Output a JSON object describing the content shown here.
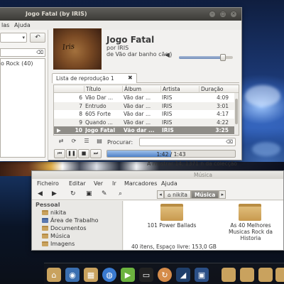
{
  "rhythmbox": {
    "window_title": "Jogo Fatal (by IRIS)",
    "menu": [
      "las",
      "Ajuda"
    ],
    "sidebar_item": "o Rock (40)",
    "now_playing": {
      "title": "Jogo Fatal",
      "artist_line": "por IRIS",
      "album_line": "de Vão dar banho cão",
      "cover_text": "Iris",
      "volume": 0.82
    },
    "playlist_tab": "Lista de reprodução 1",
    "columns": [
      "Título",
      "Álbum",
      "Artista",
      "Duração"
    ],
    "rows": [
      {
        "num": "6",
        "title": "Vão Dar ...",
        "album": "Vão dar ...",
        "artist": "IRIS",
        "duration": "4:09"
      },
      {
        "num": "7",
        "title": "Entrudo",
        "album": "Vão dar ...",
        "artist": "IRIS",
        "duration": "3:01"
      },
      {
        "num": "8",
        "title": "605 Forte",
        "album": "Vão dar ...",
        "artist": "IRIS",
        "duration": "4:17"
      },
      {
        "num": "9",
        "title": "Quando ...",
        "album": "Vão dar ...",
        "artist": "IRIS",
        "duration": "4:22"
      },
      {
        "num": "10",
        "title": "Jogo Fatal",
        "album": "Vão dar ...",
        "artist": "IRIS",
        "duration": "3:25"
      }
    ],
    "search_label": "Procurar:",
    "progress_text": "1:42 / 1:43",
    "progress": 0.5,
    "status": "A mostrar 14, 1371 n da colecção"
  },
  "nautilus": {
    "window_title": "Música",
    "menu": [
      "Ficheiro",
      "Editar",
      "Ver",
      "Ir",
      "Marcadores",
      "Ajuda"
    ],
    "breadcrumbs": [
      "nikita",
      "Música"
    ],
    "sidebar_header": "Pessoal",
    "sidebar_items": [
      "nikita",
      "Área de Trabalho",
      "Documentos",
      "Música",
      "Imagens"
    ],
    "folders": [
      {
        "name": "101 Power Ballads"
      },
      {
        "name": "As 40 Melhores Musicas Rock da Historia"
      }
    ],
    "status": "40 itens, Espaço livre: 153,0 GB"
  },
  "dock_icons": [
    "home-folder-icon",
    "eye-icon",
    "image-viewer-icon",
    "globe-icon",
    "media-player-icon",
    "terminal-icon",
    "update-icon",
    "system-monitor-icon",
    "computer-icon",
    "folder-icon",
    "folder-icon",
    "folder-icon",
    "folder-icon"
  ],
  "colors": {
    "accent": "#4f82c8",
    "titlebar": "#3b3a36",
    "folder": "#d4a75e",
    "playing_row": "#8f8d88"
  }
}
